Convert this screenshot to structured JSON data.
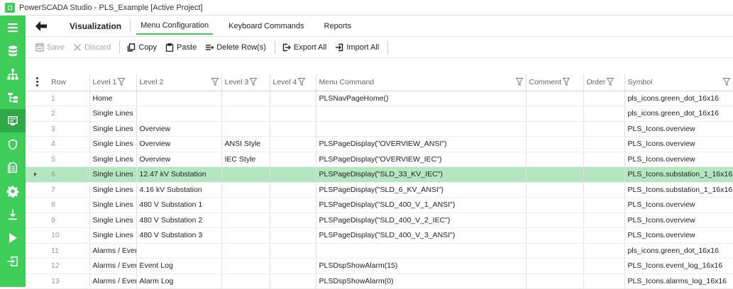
{
  "window": {
    "title": "PowerSCADA Studio - PLS_Example [Active Project]"
  },
  "header": {
    "section": "Visualization",
    "tabs": [
      {
        "label": "Menu Configuration",
        "active": true
      },
      {
        "label": "Keyboard Commands",
        "active": false
      },
      {
        "label": "Reports",
        "active": false
      }
    ]
  },
  "toolbar": {
    "save": "Save",
    "discard": "Discard",
    "copy": "Copy",
    "paste": "Paste",
    "delete_rows": "Delete Row(s)",
    "export_all": "Export All",
    "import_all": "Import All"
  },
  "grid": {
    "columns": [
      "Row",
      "Level 1",
      "Level 2",
      "Level 3",
      "Level 4",
      "Menu Command",
      "Comment",
      "Order",
      "Symbol"
    ],
    "selected_row": 6,
    "rows": [
      {
        "row": "1",
        "l1": "Home",
        "l2": "",
        "l3": "",
        "l4": "",
        "cmd": "PLSNavPageHome()",
        "comment": "",
        "order": "",
        "symbol": "pls_icons.green_dot_16x16"
      },
      {
        "row": "2",
        "l1": "Single Lines",
        "l2": "",
        "l3": "",
        "l4": "",
        "cmd": "",
        "comment": "",
        "order": "",
        "symbol": "pls_icons.green_dot_16x16"
      },
      {
        "row": "3",
        "l1": "Single Lines",
        "l2": "Overview",
        "l3": "",
        "l4": "",
        "cmd": "",
        "comment": "",
        "order": "",
        "symbol": "PLS_Icons.overview"
      },
      {
        "row": "4",
        "l1": "Single Lines",
        "l2": "Overview",
        "l3": "ANSI Style",
        "l4": "",
        "cmd": "PLSPageDisplay(\"OVERVIEW_ANSI\")",
        "comment": "",
        "order": "",
        "symbol": "PLS_Icons.overview"
      },
      {
        "row": "5",
        "l1": "Single Lines",
        "l2": "Overview",
        "l3": "IEC Style",
        "l4": "",
        "cmd": "PLSPageDisplay(\"OVERVIEW_IEC\")",
        "comment": "",
        "order": "",
        "symbol": "PLS_Icons.overview"
      },
      {
        "row": "6",
        "l1": "Single Lines",
        "l2": "12.47 kV Substation",
        "l3": "",
        "l4": "",
        "cmd": "PLSPageDisplay(\"SLD_33_KV_IEC\")",
        "comment": "",
        "order": "",
        "symbol": "PLS_Icons.substation_1_16x16"
      },
      {
        "row": "7",
        "l1": "Single Lines",
        "l2": "4.16 kV Substation",
        "l3": "",
        "l4": "",
        "cmd": "PLSPageDisplay(\"SLD_6_KV_ANSI\")",
        "comment": "",
        "order": "",
        "symbol": "PLS_Icons.substation_1_16x16"
      },
      {
        "row": "8",
        "l1": "Single Lines",
        "l2": "480 V Substation 1",
        "l3": "",
        "l4": "",
        "cmd": "PLSPageDisplay(\"SLD_400_V_1_ANSI\")",
        "comment": "",
        "order": "",
        "symbol": "PLS_Icons.overview"
      },
      {
        "row": "9",
        "l1": "Single Lines",
        "l2": "480 V Substation 2",
        "l3": "",
        "l4": "",
        "cmd": "PLSPageDisplay(\"SLD_400_V_2_IEC\")",
        "comment": "",
        "order": "",
        "symbol": "PLS_Icons.overview"
      },
      {
        "row": "10",
        "l1": "Single Lines",
        "l2": "480 V Substation 3",
        "l3": "",
        "l4": "",
        "cmd": "PLSPageDisplay(\"SLD_400_V_3_ANSI\")",
        "comment": "",
        "order": "",
        "symbol": "PLS_Icons.overview"
      },
      {
        "row": "11",
        "l1": "Alarms / Event",
        "l2": "",
        "l3": "",
        "l4": "",
        "cmd": "",
        "comment": "",
        "order": "",
        "symbol": "pls_icons.green_dot_16x16"
      },
      {
        "row": "12",
        "l1": "Alarms / Event",
        "l2": "Event Log",
        "l3": "",
        "l4": "",
        "cmd": "PLSDspShowAlarm(15)",
        "comment": "",
        "order": "",
        "symbol": "PLS_Icons.event_log_16x16"
      },
      {
        "row": "13",
        "l1": "Alarms / Event",
        "l2": "Alarm Log",
        "l3": "",
        "l4": "",
        "cmd": "PLSDspShowAlarm(0)",
        "comment": "",
        "order": "",
        "symbol": "PLS_Icons.alarms_log_16x16"
      }
    ]
  },
  "sidebar": {
    "items": [
      {
        "icon": "menu-icon"
      },
      {
        "icon": "database-icon"
      },
      {
        "icon": "network-icon"
      },
      {
        "icon": "tree-icon"
      },
      {
        "icon": "visualization-icon"
      },
      {
        "icon": "shield-icon"
      },
      {
        "icon": "document-icon"
      },
      {
        "icon": "settings-icon"
      },
      {
        "icon": "download-icon"
      },
      {
        "icon": "play-icon"
      },
      {
        "icon": "exit-icon"
      }
    ]
  },
  "colors": {
    "accent": "#3dcd58",
    "selected_row": "#b6e6c0"
  }
}
